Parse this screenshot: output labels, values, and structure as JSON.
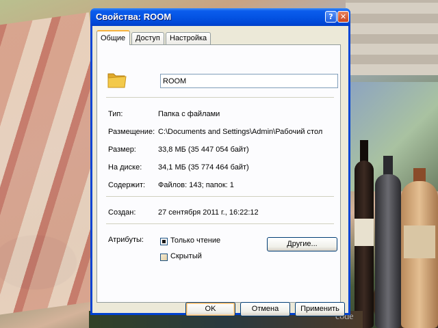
{
  "window": {
    "title": "Свойства: ROOM",
    "help_glyph": "?",
    "close_glyph": "✕"
  },
  "tabs": [
    {
      "label": "Общие",
      "active": true
    },
    {
      "label": "Доступ",
      "active": false
    },
    {
      "label": "Настройка",
      "active": false
    }
  ],
  "general": {
    "name_value": "ROOM",
    "icon": "folder-icon",
    "type_label": "Тип:",
    "type_value": "Папка с файлами",
    "location_label": "Размещение:",
    "location_value": "C:\\Documents and Settings\\Admin\\Рабочий стол",
    "size_label": "Размер:",
    "size_value": "33,8 МБ (35 447 054 байт)",
    "ondisk_label": "На диске:",
    "ondisk_value": "34,1 МБ (35 774 464 байт)",
    "contains_label": "Содержит:",
    "contains_value": "Файлов: 143; папок: 1",
    "created_label": "Создан:",
    "created_value": "27 сентября 2011 г., 16:22:12",
    "attributes_label": "Атрибуты:",
    "readonly_label": "Только чтение",
    "readonly_checked": true,
    "hidden_label": "Скрытый",
    "hidden_checked": false,
    "other_button": "Другие..."
  },
  "buttons": {
    "ok": "OK",
    "cancel": "Отмена",
    "apply": "Применить"
  },
  "desktop": {
    "corner_text": "code"
  },
  "colors": {
    "titlebar": "#0047d6",
    "dialog_bg": "#ece9d8",
    "tab_highlight": "#f7b23b",
    "folder_yellow": "#f3c94a"
  }
}
